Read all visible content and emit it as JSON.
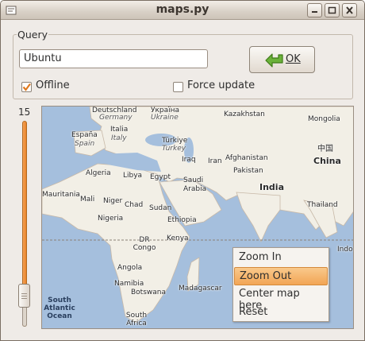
{
  "window": {
    "title": "maps.py"
  },
  "query": {
    "group_label": "Query",
    "value": "Ubuntu",
    "ok_label": "OK"
  },
  "options": {
    "offline_label": "Offline",
    "offline_checked": true,
    "force_update_label": "Force update",
    "force_update_checked": false
  },
  "zoom": {
    "level": "15"
  },
  "map": {
    "labels": {
      "deutschland": "Deutschland",
      "germany": "Germany",
      "ukraina_uk": "Україна",
      "ukraine": "Ukraine",
      "kazakhstan": "Kazakhstan",
      "mongolia": "Mongolia",
      "italia": "Italia",
      "italy": "Italy",
      "espana": "España",
      "spain": "Spain",
      "turkiye": "Türkiye",
      "turkey": "Turkey",
      "china_zh": "中国",
      "china": "China",
      "iraq": "Iraq",
      "iran": "Iran",
      "afghanistan": "Afghanistan",
      "pakistan": "Pakistan",
      "algeria": "Algeria",
      "libya": "Libya",
      "egypt": "Egypt",
      "saudi_arabia": "Saudi Arabia",
      "india": "India",
      "mauritania": "Mauritania",
      "mali": "Mali",
      "niger": "Niger",
      "chad": "Chad",
      "sudan": "Sudan",
      "nigeria": "Nigeria",
      "ethiopia": "Ethiopia",
      "thailand": "Thailand",
      "dr_congo": "DR Congo",
      "kenya": "Kenya",
      "angola": "Angola",
      "namibia": "Namibia",
      "botswana": "Botswana",
      "madagascar": "Madagascar",
      "south_africa": "South Africa",
      "south_atlantic_ocean": "South Atlantic Ocean",
      "indo": "Indo"
    }
  },
  "context_menu": {
    "items": [
      "Zoom In",
      "Zoom Out",
      "Center map here",
      "Reset"
    ],
    "active_index": 1
  },
  "colors": {
    "slider_fill": "#f08c35",
    "menu_highlight": "#f4b46a",
    "ok_arrow": "#5aa02c",
    "land": "#f2efe6",
    "water": "#a5bfdd"
  }
}
